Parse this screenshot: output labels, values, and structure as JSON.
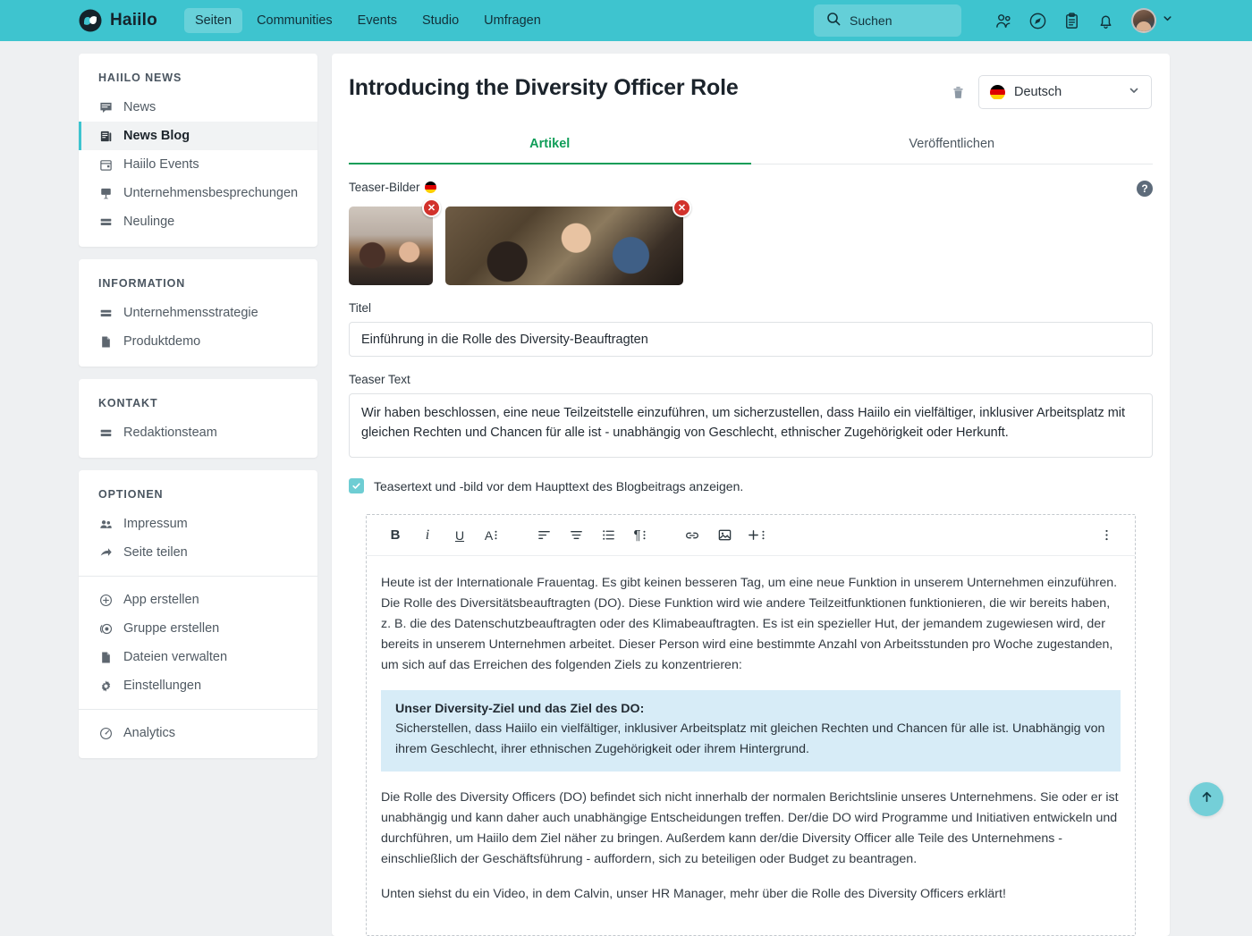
{
  "topbar": {
    "brand": "Haiilo",
    "brand_icon": "haiilo-logo-icon",
    "nav": [
      {
        "label": "Seiten",
        "active": true
      },
      {
        "label": "Communities",
        "active": false
      },
      {
        "label": "Events",
        "active": false
      },
      {
        "label": "Studio",
        "active": false
      },
      {
        "label": "Umfragen",
        "active": false
      }
    ],
    "search": {
      "placeholder": "Suchen",
      "icon": "search-icon"
    },
    "icons": [
      {
        "name": "people-icon"
      },
      {
        "name": "compass-icon"
      },
      {
        "name": "clipboard-icon"
      },
      {
        "name": "bell-icon"
      }
    ],
    "avatar_icon": "user-avatar",
    "avatar_chevron": "chevron-down-icon",
    "accent": "#3ec4cf"
  },
  "sidebar": {
    "groups": [
      {
        "title": "HAIILO NEWS",
        "items": [
          {
            "label": "News",
            "icon": "comment-icon",
            "active": false
          },
          {
            "label": "News Blog",
            "icon": "blog-icon",
            "active": true
          },
          {
            "label": "Haiilo Events",
            "icon": "calendar-icon",
            "active": false
          },
          {
            "label": "Unternehmensbesprechungen",
            "icon": "presentation-icon",
            "active": false
          },
          {
            "label": "Neulinge",
            "icon": "list-icon",
            "active": false
          }
        ]
      },
      {
        "title": "INFORMATION",
        "items": [
          {
            "label": "Unternehmensstrategie",
            "icon": "list-icon",
            "active": false
          },
          {
            "label": "Produktdemo",
            "icon": "file-icon",
            "active": false
          }
        ]
      },
      {
        "title": "KONTAKT",
        "items": [
          {
            "label": "Redaktionsteam",
            "icon": "list-icon",
            "active": false
          }
        ]
      },
      {
        "title": "OPTIONEN",
        "items": [
          {
            "label": "Impressum",
            "icon": "people-icon",
            "active": false
          },
          {
            "label": "Seite teilen",
            "icon": "share-icon",
            "active": false
          }
        ]
      }
    ],
    "actions": [
      {
        "label": "App erstellen",
        "icon": "plus-circle-icon"
      },
      {
        "label": "Gruppe erstellen",
        "icon": "group-circle-icon"
      },
      {
        "label": "Dateien verwalten",
        "icon": "file-icon"
      },
      {
        "label": "Einstellungen",
        "icon": "gear-icon"
      }
    ],
    "footer": [
      {
        "label": "Analytics",
        "icon": "analytics-icon"
      }
    ]
  },
  "main": {
    "title": "Introducing the Diversity Officer Role",
    "delete_icon": "trash-icon",
    "language": {
      "value": "Deutsch",
      "flag": "german-flag-icon",
      "chevron": "chevron-down-icon"
    },
    "tabs": [
      {
        "label": "Artikel",
        "active": true
      },
      {
        "label": "Veröffentlichen",
        "active": false
      }
    ],
    "accent_tab": "#0f9d58",
    "teaser": {
      "label": "Teaser-Bilder",
      "flag": "german-flag-icon",
      "help_icon": "help-icon",
      "help_glyph": "?",
      "images": [
        {
          "name": "teaser-image-1",
          "remove_glyph": "✕"
        },
        {
          "name": "teaser-image-2",
          "remove_glyph": "✕"
        }
      ]
    },
    "title_field": {
      "label": "Titel",
      "value": "Einführung in die Rolle des Diversity-Beauftragten",
      "placeholder": ""
    },
    "teaser_text_field": {
      "label": "Teaser Text",
      "value": "Wir haben beschlossen, eine neue Teilzeitstelle einzuführen, um sicherzustellen, dass Haiilo ein vielfältiger, inklusiver Arbeitsplatz mit gleichen Rechten und Chancen für alle ist - unabhängig von Geschlecht, ethnischer Zugehörigkeit oder Herkunft.",
      "placeholder": ""
    },
    "checkbox": {
      "checked": true,
      "label": "Teasertext und -bild vor dem Haupttext des Blogbeitrags anzeigen."
    }
  },
  "editor": {
    "toolbar": [
      {
        "name": "bold-icon",
        "glyph": "B"
      },
      {
        "name": "italic-icon",
        "glyph": "i"
      },
      {
        "name": "underline-icon",
        "glyph": "U"
      },
      {
        "name": "text-style-icon",
        "glyph": "A"
      },
      {
        "name": "align-left-icon",
        "glyph": ""
      },
      {
        "name": "align-center-icon",
        "glyph": ""
      },
      {
        "name": "list-icon",
        "glyph": ""
      },
      {
        "name": "paragraph-icon",
        "glyph": "¶"
      },
      {
        "name": "link-icon",
        "glyph": ""
      },
      {
        "name": "image-icon",
        "glyph": ""
      },
      {
        "name": "add-icon",
        "glyph": "+"
      }
    ],
    "more_icon": "more-vertical-icon",
    "paragraphs": [
      "Heute ist der Internationale Frauentag. Es gibt keinen besseren Tag, um eine neue Funktion in unserem Unternehmen einzuführen. Die Rolle des Diversitätsbeauftragten (DO). Diese Funktion wird wie andere Teilzeitfunktionen funktionieren, die wir bereits haben, z. B. die des Datenschutzbeauftragten oder des Klimabeauftragten. Es ist ein spezieller Hut, der jemandem zugewiesen wird, der bereits in unserem Unternehmen arbeitet. Dieser Person wird eine bestimmte Anzahl von Arbeitsstunden pro Woche zugestanden, um sich auf das Erreichen des folgenden Ziels zu konzentrieren:"
    ],
    "callout": {
      "title": "Unser Diversity-Ziel und das Ziel des DO:",
      "body": "Sicherstellen, dass Haiilo ein vielfältiger, inklusiver Arbeitsplatz mit gleichen Rechten und Chancen für alle ist. Unabhängig von ihrem Geschlecht, ihrer ethnischen Zugehörigkeit oder ihrem Hintergrund.",
      "bg": "#d7ecf7"
    },
    "paragraphs_after": [
      "Die Rolle des Diversity Officers (DO) befindet sich nicht innerhalb der normalen Berichtslinie unseres Unternehmens. Sie oder er ist unabhängig und kann daher auch unabhängige Entscheidungen treffen. Der/die DO wird Programme und Initiativen entwickeln und durchführen, um Haiilo dem Ziel näher zu bringen. Außerdem kann der/die Diversity Officer alle Teile des Unternehmens - einschließlich der Geschäftsführung - auffordern, sich zu beteiligen oder Budget zu beantragen.",
      "Unten siehst du ein Video, in dem Calvin, unser HR Manager, mehr über die Rolle des Diversity Officers erklärt!"
    ]
  },
  "fab": {
    "name": "scroll-to-top-button",
    "icon": "arrow-up-icon",
    "color": "#74cfd8"
  }
}
